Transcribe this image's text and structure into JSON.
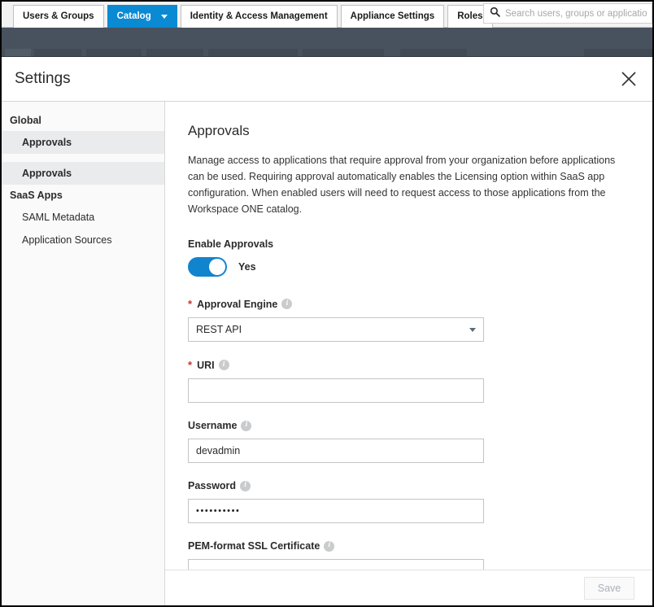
{
  "window": {
    "tabs": [
      {
        "label": "Users & Groups",
        "active": false,
        "has_caret": false
      },
      {
        "label": "Catalog",
        "active": true,
        "has_caret": true
      },
      {
        "label": "Identity & Access Management",
        "active": false,
        "has_caret": false
      },
      {
        "label": "Appliance Settings",
        "active": false,
        "has_caret": false
      },
      {
        "label": "Roles",
        "active": false,
        "has_caret": false
      }
    ],
    "search": {
      "placeholder": "Search users, groups or applicatio",
      "icon": "search-icon"
    },
    "accent_color": "#0b8ad4",
    "subnav_color": "#48525e"
  },
  "panel": {
    "title": "Settings",
    "close_icon": "close-icon"
  },
  "sidebar": {
    "sections": [
      {
        "type": "group",
        "label": "Global"
      },
      {
        "type": "item",
        "label": "Approvals",
        "selected": true,
        "bold": true
      },
      {
        "type": "spacer"
      },
      {
        "type": "item",
        "label": "Approvals",
        "selected": true,
        "bold": true
      },
      {
        "type": "group",
        "label": "SaaS Apps"
      },
      {
        "type": "item",
        "label": "SAML Metadata",
        "selected": false,
        "bold": false
      },
      {
        "type": "item",
        "label": "Application Sources",
        "selected": false,
        "bold": false
      }
    ]
  },
  "main": {
    "heading": "Approvals",
    "description": "Manage access to applications that require approval from your organization before applications can be used. Requiring approval automatically enables the Licensing option within SaaS app configuration. When enabled users will need to request access to those applications from the Workspace ONE catalog.",
    "enable_approvals": {
      "label": "Enable Approvals",
      "toggle_state": "Yes",
      "toggle_on": true,
      "toggle_color": "#1184ce"
    },
    "fields": [
      {
        "name": "approval-engine",
        "label": "Approval Engine",
        "required": true,
        "required_marker": "*",
        "has_info": true,
        "control": "select",
        "value": "REST API",
        "options": [
          "REST API"
        ]
      },
      {
        "name": "uri",
        "label": "URI",
        "required": true,
        "required_marker": "*",
        "has_info": true,
        "control": "text",
        "value": "",
        "placeholder": ""
      },
      {
        "name": "username",
        "label": "Username",
        "required": false,
        "required_marker": "",
        "has_info": true,
        "control": "text",
        "value": "devadmin",
        "placeholder": ""
      },
      {
        "name": "password",
        "label": "Password",
        "required": false,
        "required_marker": "",
        "has_info": true,
        "control": "password",
        "value": "••••••••••",
        "placeholder": ""
      },
      {
        "name": "pem-ssl-certificate",
        "label": "PEM-format SSL Certificate",
        "required": false,
        "required_marker": "",
        "has_info": true,
        "control": "text",
        "value": "",
        "placeholder": ""
      }
    ],
    "info_glyph": "i"
  },
  "footer": {
    "save_label": "Save",
    "save_enabled": false
  }
}
